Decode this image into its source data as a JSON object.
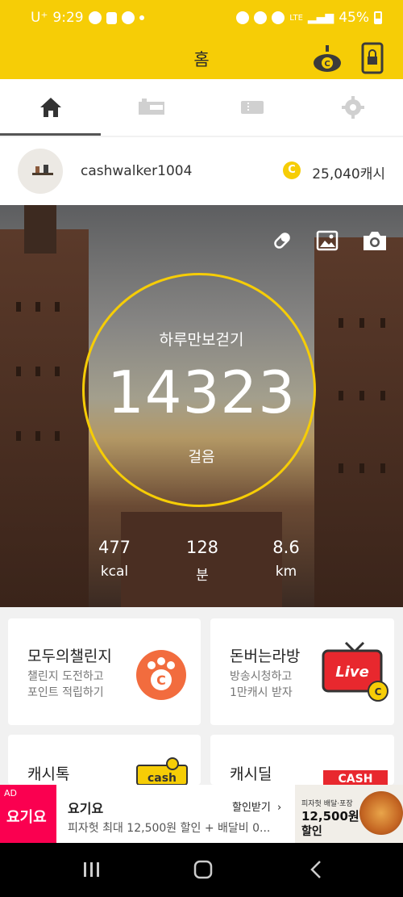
{
  "status_bar": {
    "carrier": "U⁺",
    "time": "9:29",
    "network": "LTE",
    "battery": "45%"
  },
  "app_bar": {
    "title": "홈"
  },
  "tabs": [
    {
      "icon": "home-icon",
      "active": true
    },
    {
      "icon": "coupon-icon",
      "active": false
    },
    {
      "icon": "ticket-icon",
      "active": false
    },
    {
      "icon": "gear-icon",
      "active": false
    }
  ],
  "profile": {
    "username": "cashwalker1004",
    "coin_symbol": "C",
    "cash": "25,040캐시"
  },
  "pedometer": {
    "label": "하루만보걷기",
    "steps": "14323",
    "unit": "걸음",
    "stats": [
      {
        "value": "477",
        "unit": "kcal"
      },
      {
        "value": "128",
        "unit": "분"
      },
      {
        "value": "8.6",
        "unit": "km"
      }
    ]
  },
  "cards": [
    {
      "title": "모두의챌린지",
      "line1": "챌린지 도전하고",
      "line2": "포인트 적립하기",
      "badge": "C"
    },
    {
      "title": "돈버는라방",
      "line1": "방송시청하고",
      "line2": "1만캐시 받자",
      "badge": "Live"
    },
    {
      "title": "캐시톡",
      "badge": "cash"
    },
    {
      "title": "캐시딜",
      "badge": "CASH"
    }
  ],
  "ad": {
    "tag": "AD",
    "brand": "요기요",
    "title": "요기요",
    "cta": "할인받기",
    "description": "피자헛 최대 12,500원 할인 + 배달비 0...",
    "image_small": "피자헛 배달·포장",
    "image_big": "12,500원",
    "image_big2": "할인"
  },
  "colors": {
    "accent": "#f6cd06",
    "ad_brand": "#fa0050",
    "challenge_orange": "#f26c3e",
    "live_red": "#e8282e"
  }
}
